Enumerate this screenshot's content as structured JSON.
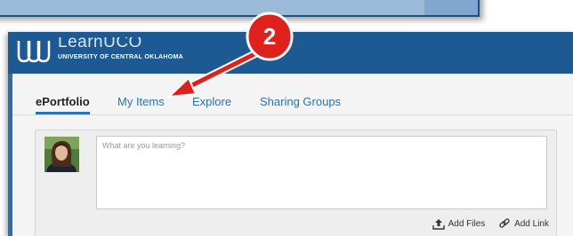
{
  "brand": {
    "name": "LearnUCO",
    "subtitle": "UNIVERSITY OF CENTRAL OKLAHOMA"
  },
  "tabs": [
    {
      "label": "ePortfolio",
      "active": true
    },
    {
      "label": "My Items",
      "active": false
    },
    {
      "label": "Explore",
      "active": false
    },
    {
      "label": "Sharing Groups",
      "active": false
    }
  ],
  "post": {
    "placeholder": "What are you learning?",
    "add_files_label": "Add Files",
    "add_link_label": "Add Link"
  },
  "callout": {
    "number": "2",
    "color": "#e0201b"
  },
  "colors": {
    "header": "#1d5a93",
    "accent": "#2b71b8"
  }
}
